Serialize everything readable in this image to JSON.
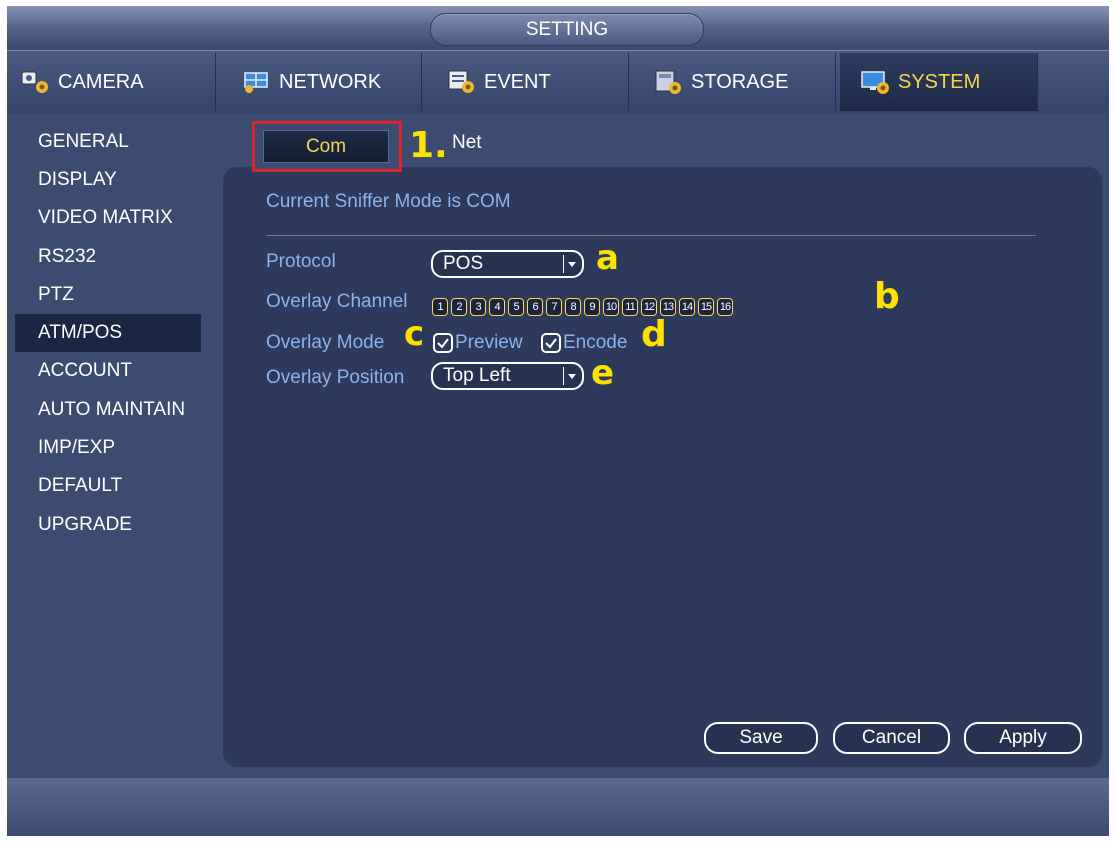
{
  "window": {
    "title": "SETTING"
  },
  "tabs": [
    {
      "label": "CAMERA",
      "icon": "camera-gear-icon"
    },
    {
      "label": "NETWORK",
      "icon": "network-gear-icon"
    },
    {
      "label": "EVENT",
      "icon": "event-gear-icon"
    },
    {
      "label": "STORAGE",
      "icon": "storage-gear-icon"
    },
    {
      "label": "SYSTEM",
      "icon": "system-gear-icon",
      "active": true
    }
  ],
  "menu": [
    {
      "label": "GENERAL"
    },
    {
      "label": "DISPLAY"
    },
    {
      "label": "VIDEO MATRIX"
    },
    {
      "label": "RS232"
    },
    {
      "label": "PTZ"
    },
    {
      "label": "ATM/POS",
      "active": true
    },
    {
      "label": "ACCOUNT"
    },
    {
      "label": "AUTO MAINTAIN"
    },
    {
      "label": "IMP/EXP"
    },
    {
      "label": "DEFAULT"
    },
    {
      "label": "UPGRADE"
    }
  ],
  "subtabs": {
    "com": "Com",
    "net": "Net"
  },
  "sniffer_mode": "Current Sniffer Mode is COM",
  "form": {
    "protocol_label": "Protocol",
    "protocol_value": "POS",
    "overlay_channel_label": "Overlay Channel",
    "channels": [
      "1",
      "2",
      "3",
      "4",
      "5",
      "6",
      "7",
      "8",
      "9",
      "10",
      "11",
      "12",
      "13",
      "14",
      "15",
      "16"
    ],
    "overlay_mode_label": "Overlay Mode",
    "preview_label": "Preview",
    "preview_checked": true,
    "encode_label": "Encode",
    "encode_checked": true,
    "overlay_position_label": "Overlay Position",
    "overlay_position_value": "Top Left"
  },
  "annotations": {
    "step": "1.",
    "a": "a",
    "b": "b",
    "c": "c",
    "d": "d",
    "e": "e"
  },
  "buttons": {
    "save": "Save",
    "cancel": "Cancel",
    "apply": "Apply"
  },
  "colors": {
    "accent": "#f2d64a",
    "label": "#8ab4ec",
    "highlight_box": "#d9262b",
    "annotation": "#ffe100"
  }
}
